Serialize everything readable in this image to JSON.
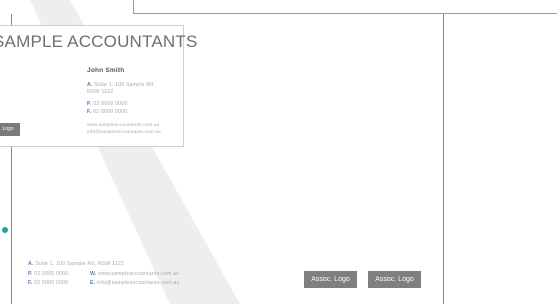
{
  "card": {
    "company": "SAMPLE ACCOUNTANTS",
    "person_name": "John Smith",
    "address_label": "A.",
    "address_line1": "Suite 1, 100 Sample Rd,",
    "address_line2": "NSW 1122",
    "phone_label": "P.",
    "phone": "02 0000 0000",
    "fax_label": "F.",
    "fax": "02 0000 0000",
    "website": "www.sampleaccountants.com.au",
    "email": "info@sampleaccountants.com.au",
    "logo_label": "Logo"
  },
  "letterhead_footer": {
    "address_label": "A.",
    "address": "Suite 1, 100 Sample Rd, NSW 1122",
    "phone_label": "P.",
    "phone": "02 0000 0000",
    "web_label": "W.",
    "website": "www.sampleaccountants.com.au",
    "fax_label": "F.",
    "fax": "02 0000 0000",
    "email_label": "E.",
    "email": "info@sampleaccountants.com.au"
  },
  "assoc_logos": [
    "Assoc. Logo",
    "Assoc. Logo"
  ],
  "colors": {
    "accent_dot": "#1ba6a6",
    "logo_box": "#7f7f7f",
    "stripe": "#eeeeee"
  }
}
